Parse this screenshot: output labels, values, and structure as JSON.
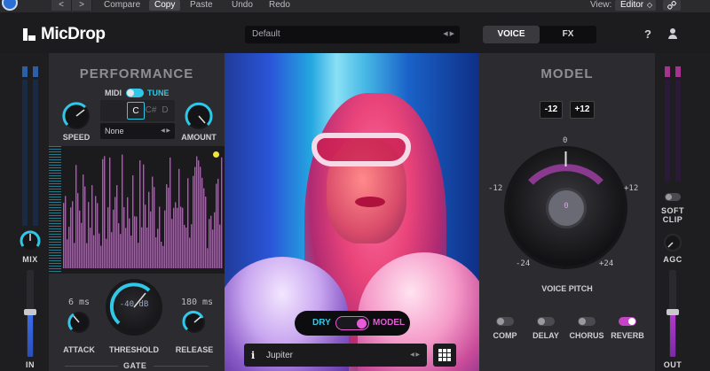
{
  "host": {
    "nav_back": "<",
    "nav_forward": ">",
    "compare": "Compare",
    "copy": "Copy",
    "paste": "Paste",
    "undo": "Undo",
    "redo": "Redo",
    "view_label": "View:",
    "view_value": "Editor",
    "view_arrows": "◇",
    "link_icon": "link-icon"
  },
  "header": {
    "brand": "MicDrop",
    "preset": "Default",
    "preset_arrows": "◀ ▶",
    "tabs": [
      "VOICE",
      "FX"
    ],
    "active_tab": "VOICE",
    "help": "?"
  },
  "meters": {
    "in_label": "IN",
    "out_label": "OUT",
    "mix_label": "MIX",
    "soft_clip_label": "SOFT CLIP",
    "agc_label": "AGC"
  },
  "performance": {
    "title": "PERFORMANCE",
    "midi_label": "MIDI",
    "tune_label": "TUNE",
    "speed_label": "SPEED",
    "amount_label": "AMOUNT",
    "keys": [
      "C",
      "C#",
      "D"
    ],
    "selected_key": "C",
    "scale_value": "None",
    "scale_arrows": "◀ ▶",
    "attack_value": "6 ms",
    "attack_label": "ATTACK",
    "threshold_value": "-40 dB",
    "threshold_label": "THRESHOLD",
    "release_value": "180 ms",
    "release_label": "RELEASE",
    "gate_label": "GATE"
  },
  "center": {
    "dry_label": "DRY",
    "model_label": "MODEL",
    "voice_info": "i",
    "voice_name": "Jupiter",
    "voice_arrows": "◀ ▶"
  },
  "model": {
    "title": "MODEL",
    "minus12": "-12",
    "plus12": "+12",
    "pitch_ticks": {
      "top": "0",
      "left": "-12",
      "right": "+12",
      "bottom_left": "-24",
      "bottom_right": "+24"
    },
    "pitch_value": "0",
    "pitch_label": "VOICE PITCH",
    "fx": [
      {
        "label": "COMP",
        "on": false
      },
      {
        "label": "DELAY",
        "on": false
      },
      {
        "label": "CHORUS",
        "on": false
      },
      {
        "label": "REVERB",
        "on": true
      }
    ]
  },
  "colors": {
    "accent_cyan": "#2fc8e8",
    "accent_magenta": "#e85ad8",
    "panel": "#2c2c30",
    "background": "#1e1e20"
  }
}
